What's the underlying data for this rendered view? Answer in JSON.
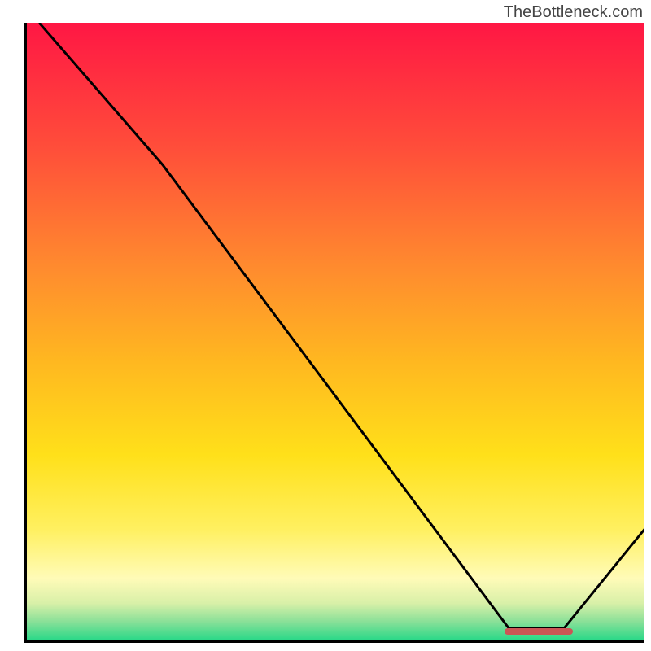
{
  "watermark": "TheBottleneck.com",
  "chart_data": {
    "type": "line",
    "title": "",
    "xlabel": "",
    "ylabel": "",
    "xlim": [
      0,
      100
    ],
    "ylim": [
      0,
      100
    ],
    "curve_points": [
      {
        "x": 2,
        "y": 100
      },
      {
        "x": 22,
        "y": 77
      },
      {
        "x": 78,
        "y": 2
      },
      {
        "x": 87,
        "y": 2
      },
      {
        "x": 100,
        "y": 18
      }
    ],
    "marker": {
      "x_start": 77,
      "x_end": 88,
      "y": 1.5,
      "color": "#cc5555"
    },
    "gradient_stops": [
      {
        "pos": 0,
        "color": "#ff1744"
      },
      {
        "pos": 20,
        "color": "#ff4d3a"
      },
      {
        "pos": 40,
        "color": "#ff8c2e"
      },
      {
        "pos": 55,
        "color": "#ffb820"
      },
      {
        "pos": 70,
        "color": "#ffe01a"
      },
      {
        "pos": 82,
        "color": "#fff060"
      },
      {
        "pos": 90,
        "color": "#fffbb8"
      },
      {
        "pos": 94,
        "color": "#d8f0a8"
      },
      {
        "pos": 97,
        "color": "#88e098"
      },
      {
        "pos": 100,
        "color": "#28d888"
      }
    ]
  }
}
